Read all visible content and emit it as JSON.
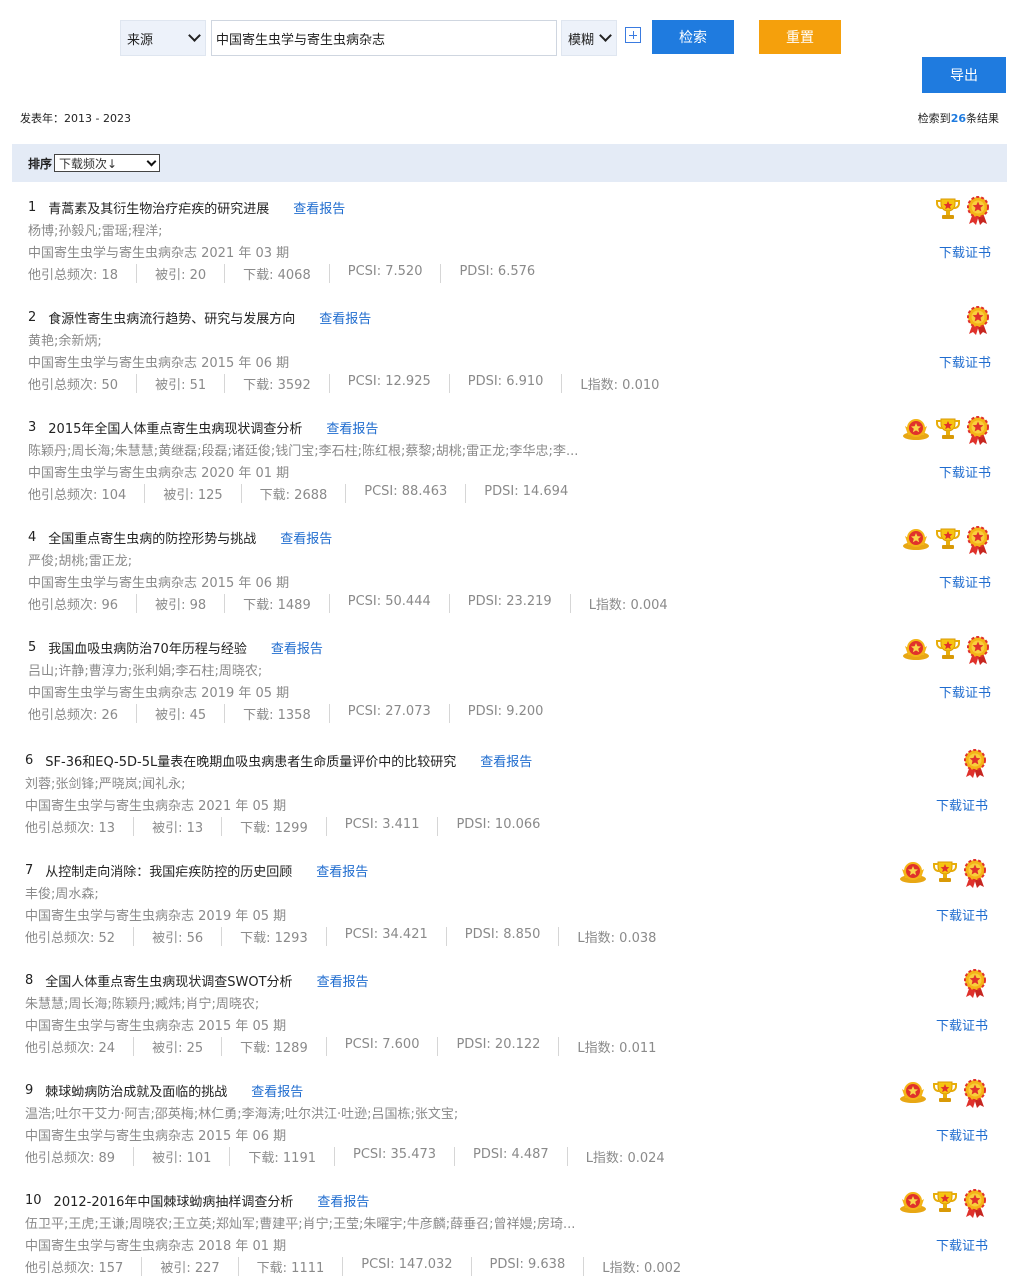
{
  "search": {
    "field_select": "来源",
    "keyword": "中国寄生虫学与寄生虫病杂志",
    "match_select": "模糊",
    "search_label": "检索",
    "reset_label": "重置",
    "export_label": "导出"
  },
  "summary": {
    "year_range": "发表年：2013 - 2023",
    "count_prefix": "检索到",
    "count": "26",
    "count_suffix": "条结果"
  },
  "sort": {
    "label": "排序",
    "selected": "下载频次↓"
  },
  "labels": {
    "report": "查看报告",
    "certificate": "下载证书"
  },
  "results": [
    {
      "num": "1",
      "title": "青蒿素及其衍生物治疗疟疾的研究进展",
      "authors": "杨博;孙毅凡;雷瑶;程洋;",
      "journal": "中国寄生虫学与寄生虫病杂志 2021 年 03 期",
      "metrics": [
        "他引总频次: 18",
        "被引: 20",
        "下载: 4068",
        "PCSI: 7.520",
        "PDSI: 6.576"
      ],
      "badges": [
        "trophy",
        "rosette"
      ]
    },
    {
      "num": "2",
      "title": "食源性寄生虫病流行趋势、研究与发展方向",
      "authors": "黄艳;余新炳;",
      "journal": "中国寄生虫学与寄生虫病杂志 2015 年 06 期",
      "metrics": [
        "他引总频次: 50",
        "被引: 51",
        "下载: 3592",
        "PCSI: 12.925",
        "PDSI: 6.910",
        "L指数: 0.010"
      ],
      "badges": [
        "rosette"
      ]
    },
    {
      "num": "3",
      "title": "2015年全国人体重点寄生虫病现状调查分析",
      "authors": "陈颖丹;周长海;朱慧慧;黄继磊;段磊;诸廷俊;钱门宝;李石柱;陈红根;蔡黎;胡桃;雷正龙;李华忠;李...",
      "journal": "中国寄生虫学与寄生虫病杂志 2020 年 01 期",
      "metrics": [
        "他引总频次: 104",
        "被引: 125",
        "下载: 2688",
        "PCSI: 88.463",
        "PDSI: 14.694"
      ],
      "badges": [
        "medal",
        "trophy",
        "rosette"
      ]
    },
    {
      "num": "4",
      "title": "全国重点寄生虫病的防控形势与挑战",
      "authors": "严俊;胡桃;雷正龙;",
      "journal": "中国寄生虫学与寄生虫病杂志 2015 年 06 期",
      "metrics": [
        "他引总频次: 96",
        "被引: 98",
        "下载: 1489",
        "PCSI: 50.444",
        "PDSI: 23.219",
        "L指数: 0.004"
      ],
      "badges": [
        "medal",
        "trophy",
        "rosette"
      ]
    },
    {
      "num": "5",
      "title": "我国血吸虫病防治70年历程与经验",
      "authors": "吕山;许静;曹淳力;张利娟;李石柱;周晓农;",
      "journal": "中国寄生虫学与寄生虫病杂志 2019 年 05 期",
      "metrics": [
        "他引总频次: 26",
        "被引: 45",
        "下载: 1358",
        "PCSI: 27.073",
        "PDSI: 9.200"
      ],
      "badges": [
        "medal",
        "trophy",
        "rosette"
      ]
    },
    {
      "num": "6",
      "title": "SF-36和EQ-5D-5L量表在晚期血吸虫病患者生命质量评价中的比较研究",
      "authors": "刘蓉;张剑锋;严晓岚;闻礼永;",
      "journal": "中国寄生虫学与寄生虫病杂志 2021 年 05 期",
      "metrics": [
        "他引总频次: 13",
        "被引: 13",
        "下载: 1299",
        "PCSI: 3.411",
        "PDSI: 10.066"
      ],
      "badges": [
        "rosette"
      ]
    },
    {
      "num": "7",
      "title": "从控制走向消除：我国疟疾防控的历史回顾",
      "authors": "丰俊;周水森;",
      "journal": "中国寄生虫学与寄生虫病杂志 2019 年 05 期",
      "metrics": [
        "他引总频次: 52",
        "被引: 56",
        "下载: 1293",
        "PCSI: 34.421",
        "PDSI: 8.850",
        "L指数: 0.038"
      ],
      "badges": [
        "medal",
        "trophy",
        "rosette"
      ]
    },
    {
      "num": "8",
      "title": "全国人体重点寄生虫病现状调查SWOT分析",
      "authors": "朱慧慧;周长海;陈颖丹;臧炜;肖宁;周晓农;",
      "journal": "中国寄生虫学与寄生虫病杂志 2015 年 05 期",
      "metrics": [
        "他引总频次: 24",
        "被引: 25",
        "下载: 1289",
        "PCSI: 7.600",
        "PDSI: 20.122",
        "L指数: 0.011"
      ],
      "badges": [
        "rosette"
      ]
    },
    {
      "num": "9",
      "title": "棘球蚴病防治成就及面临的挑战",
      "authors": "温浩;吐尔干艾力·阿吉;邵英梅;林仁勇;李海涛;吐尔洪江·吐逊;吕国栋;张文宝;",
      "journal": "中国寄生虫学与寄生虫病杂志 2015 年 06 期",
      "metrics": [
        "他引总频次: 89",
        "被引: 101",
        "下载: 1191",
        "PCSI: 35.473",
        "PDSI: 4.487",
        "L指数: 0.024"
      ],
      "badges": [
        "medal",
        "trophy",
        "rosette"
      ]
    },
    {
      "num": "10",
      "title": "2012-2016年中国棘球蚴病抽样调查分析",
      "authors": "伍卫平;王虎;王谦;周晓农;王立英;郑灿军;曹建平;肖宁;王莹;朱曜宇;牛彦麟;薛垂召;曾祥嫚;房琦...",
      "journal": "中国寄生虫学与寄生虫病杂志 2018 年 01 期",
      "metrics": [
        "他引总频次: 157",
        "被引: 227",
        "下载: 1111",
        "PCSI: 147.032",
        "PDSI: 9.638",
        "L指数: 0.002"
      ],
      "badges": [
        "medal",
        "trophy",
        "rosette"
      ]
    }
  ]
}
